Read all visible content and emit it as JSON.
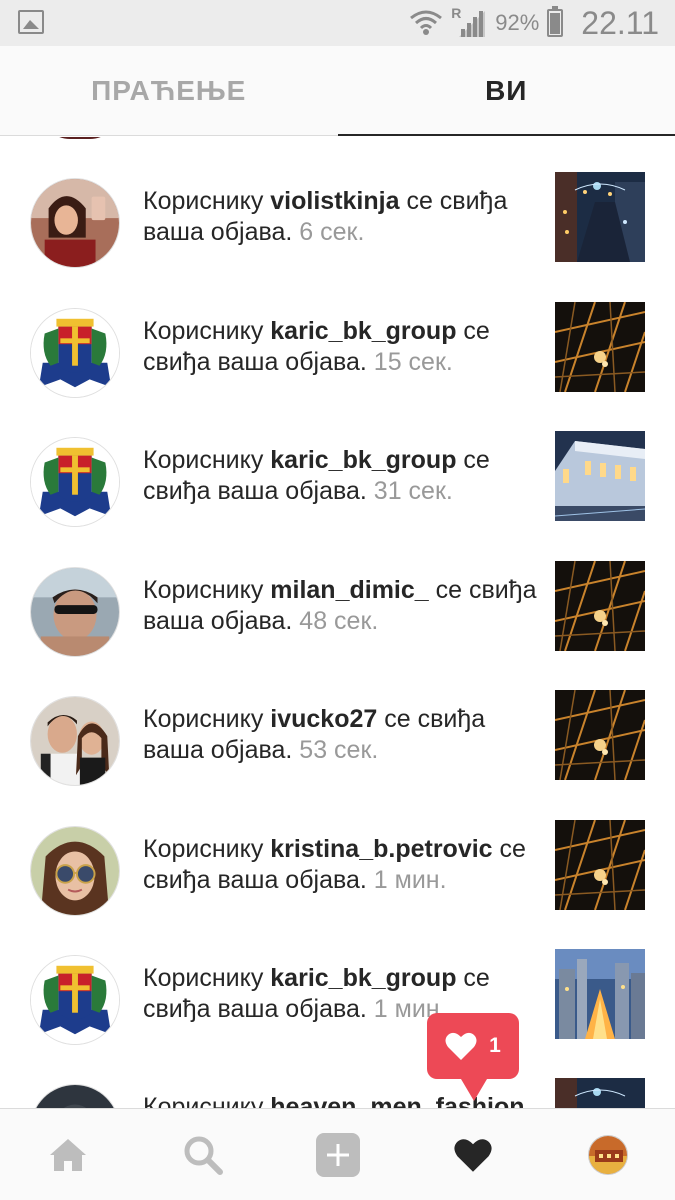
{
  "status_bar": {
    "battery_percent": "92%",
    "time": "22.11",
    "roaming_indicator": "R",
    "icons": [
      "gallery-icon",
      "wifi-icon",
      "signal-icon",
      "battery-icon"
    ]
  },
  "tabs": [
    {
      "label": "ПРАЋЕЊЕ",
      "active": false
    },
    {
      "label": "ВИ",
      "active": true
    }
  ],
  "notifications": [
    {
      "prefix": "Кориснику",
      "username": "violistkinja",
      "text": "се свиђа ваша објава.",
      "time": "6 сек."
    },
    {
      "prefix": "Кориснику",
      "username": "karic_bk_group",
      "text": "се свиђа ваша објава.",
      "time": "15 сек."
    },
    {
      "prefix": "Кориснику",
      "username": "karic_bk_group",
      "text": "се свиђа ваша објава.",
      "time": "31 сек."
    },
    {
      "prefix": "Кориснику",
      "username": "milan_dimic_",
      "text": "се свиђа ваша објава.",
      "time": "48 сек."
    },
    {
      "prefix": "Кориснику",
      "username": "ivucko27",
      "text": "се свиђа ваша објава.",
      "time": "53 сек."
    },
    {
      "prefix": "Кориснику",
      "username": "kristina_b.petrovic",
      "text": "се свиђа ваша објава.",
      "time": "1 мин."
    },
    {
      "prefix": "Кориснику",
      "username": "karic_bk_group",
      "text": "се свиђа ваша објава.",
      "time": "1 мин."
    },
    {
      "prefix": "Кориснику",
      "username": "heaven_men_fashion",
      "text": "",
      "time": ""
    }
  ],
  "activity_bubble": {
    "count": "1",
    "icon": "heart-icon",
    "color": "#ed4956"
  },
  "bottom_nav": [
    {
      "name": "home-icon"
    },
    {
      "name": "search-icon"
    },
    {
      "name": "add-post-icon"
    },
    {
      "name": "activity-heart-icon",
      "active": true
    },
    {
      "name": "profile-avatar"
    }
  ]
}
